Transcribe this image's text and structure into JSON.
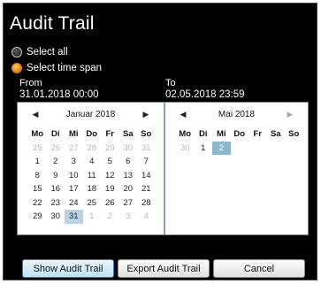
{
  "title": "Audit Trail",
  "options": {
    "select_all": "Select all",
    "select_time_span": "Select time span",
    "selected": "select_time_span"
  },
  "from": {
    "label": "From",
    "value": "31.01.2018 00:00"
  },
  "to": {
    "label": "To",
    "value": "02.05.2018 23:59"
  },
  "weekdays": [
    "Mo",
    "Di",
    "Mi",
    "Do",
    "Fr",
    "Sa",
    "So"
  ],
  "calendar_left": {
    "month": "Januar 2018",
    "days": [
      [
        "25",
        "26",
        "27",
        "28",
        "29",
        "30",
        "31"
      ],
      [
        "1",
        "2",
        "3",
        "4",
        "5",
        "6",
        "7"
      ],
      [
        "8",
        "9",
        "10",
        "11",
        "12",
        "13",
        "14"
      ],
      [
        "15",
        "16",
        "17",
        "18",
        "19",
        "20",
        "21"
      ],
      [
        "22",
        "23",
        "24",
        "25",
        "26",
        "27",
        "28"
      ],
      [
        "29",
        "30",
        "31",
        "1",
        "2",
        "3",
        "4"
      ]
    ]
  },
  "calendar_right": {
    "month": "Mai 2018",
    "days": [
      [
        "30",
        "1",
        "2"
      ]
    ]
  },
  "buttons": {
    "show": "Show Audit Trail",
    "export": "Export Audit Trail",
    "cancel": "Cancel"
  },
  "colors": {
    "background": "#000000",
    "accent_radio": "#e08a18",
    "selection": "#b8d4e4",
    "selection_strong": "#8db7cf"
  },
  "icons": {
    "prev": "chevron-left-icon",
    "next": "chevron-right-icon"
  }
}
